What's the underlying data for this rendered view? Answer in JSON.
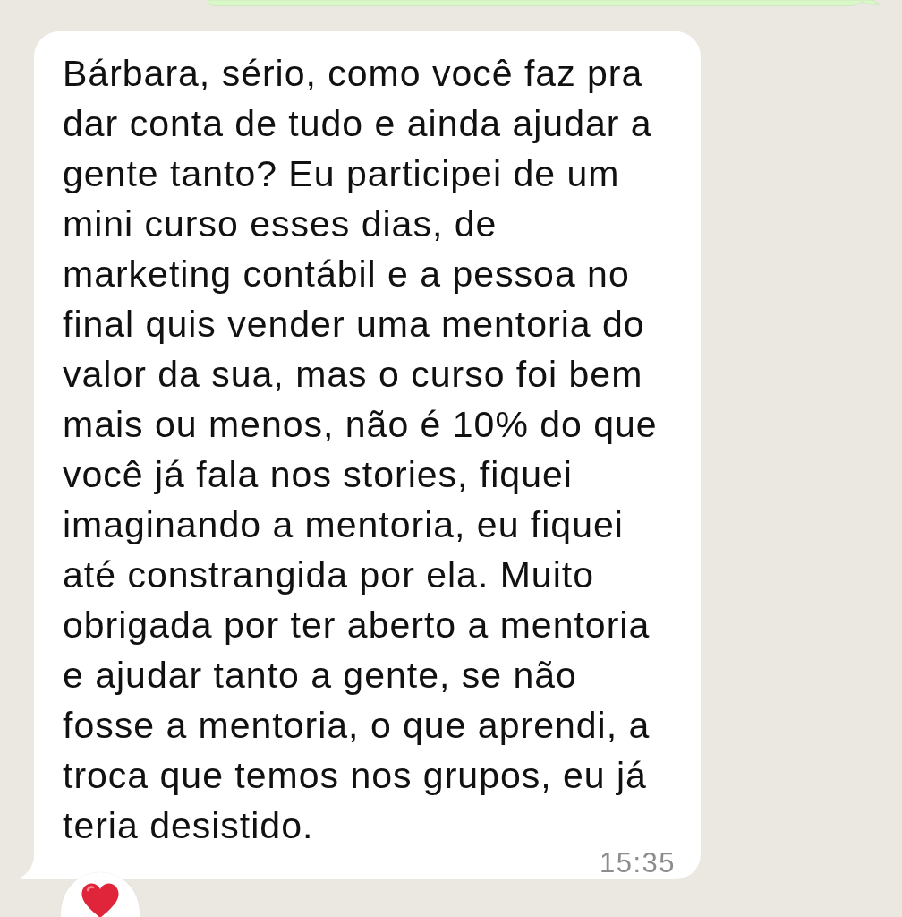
{
  "messages": [
    {
      "kind": "outgoing"
    },
    {
      "kind": "incoming",
      "text": "Bárbara, sério, como você faz pra dar conta de tudo e ainda ajudar a gente tanto? Eu participei de um mini curso esses dias, de marketing contábil e a pessoa no final quis vender uma mentoria do valor da sua, mas o curso foi bem mais ou menos, não é 10% do que você já fala nos stories, fiquei imaginando a mentoria, eu fiquei até constrangida por ela. Muito obrigada por ter aberto a mentoria e ajudar tanto a gente, se não fosse a mentoria, o que aprendi, a troca que temos nos grupos, eu já teria desistido.",
      "time": "15:35",
      "reactions": [
        {
          "kind": "heart"
        }
      ]
    }
  ]
}
